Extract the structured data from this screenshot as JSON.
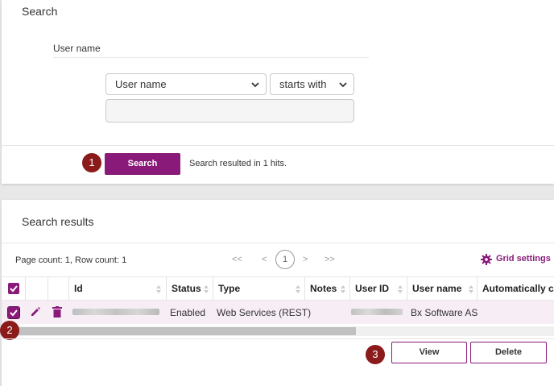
{
  "search": {
    "title": "Search",
    "field_label": "User name",
    "field_select": "User name",
    "operator_select": "starts with",
    "value": "",
    "button": "Search",
    "badge": "1",
    "status": "Search resulted in 1 hits."
  },
  "results": {
    "title": "Search results",
    "page_info": "Page count: 1, Row count: 1",
    "pager": {
      "first": "<<",
      "prev": "<",
      "current": "1",
      "next": ">",
      "last": ">>"
    },
    "grid_settings": "Grid settings",
    "columns": [
      "Id",
      "Status",
      "Type",
      "Notes",
      "User ID",
      "User name",
      "Automatically cr"
    ],
    "rows": [
      {
        "id": "",
        "status": "Enabled",
        "type": "Web Services (REST)",
        "notes": "",
        "user_id": "",
        "user_name": "Bx Software AS",
        "checked": true
      }
    ],
    "row_badge": "2",
    "actions_badge": "3",
    "view_button": "View",
    "delete_button": "Delete"
  },
  "colors": {
    "accent": "#8a1a7a",
    "badge": "#8b1a1a",
    "row_highlight": "#f7eef5"
  }
}
